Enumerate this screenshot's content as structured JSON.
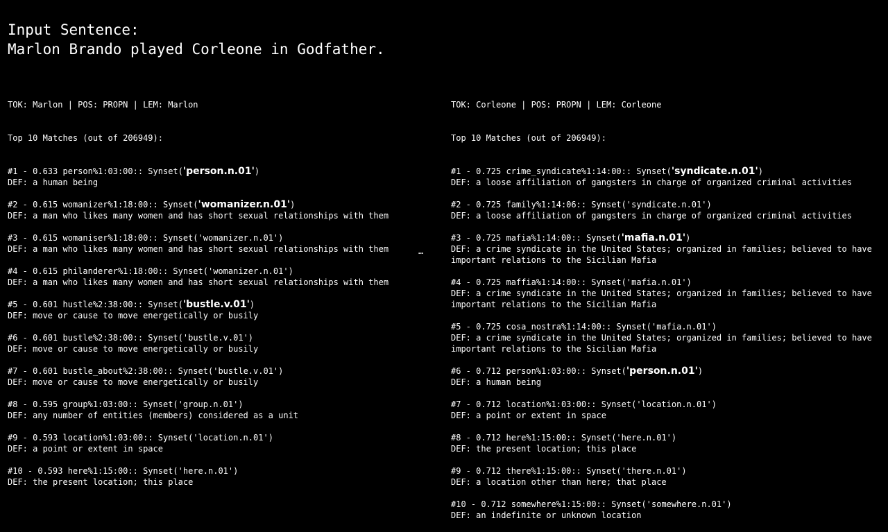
{
  "title": {
    "label": "Input Sentence:",
    "sentence": "Marlon Brando played Corleone in Godfather."
  },
  "ellipsis": "⋯",
  "columns": [
    {
      "header": "TOK: Marlon | POS: PROPN | LEM: Marlon",
      "top_matches": "Top 10 Matches (out of 206949):",
      "matches": [
        {
          "prefix": "#1 - 0.633 person%1:03:00:: Synset(",
          "synset": "'person.n.01'",
          "suffix": ")",
          "bold": true,
          "def": "DEF: a human being",
          "def2": ""
        },
        {
          "prefix": "#2 - 0.615 womanizer%1:18:00:: Synset(",
          "synset": "'womanizer.n.01'",
          "suffix": ")",
          "bold": true,
          "def": "DEF: a man who likes many women and has short sexual relationships with them",
          "def2": ""
        },
        {
          "prefix": "#3 - 0.615 womaniser%1:18:00:: Synset(",
          "synset": "'womanizer.n.01'",
          "suffix": ")",
          "bold": false,
          "def": "DEF: a man who likes many women and has short sexual relationships with them",
          "def2": ""
        },
        {
          "prefix": "#4 - 0.615 philanderer%1:18:00:: Synset(",
          "synset": "'womanizer.n.01'",
          "suffix": ")",
          "bold": false,
          "def": "DEF: a man who likes many women and has short sexual relationships with them",
          "def2": ""
        },
        {
          "prefix": "#5 - 0.601 hustle%2:38:00:: Synset(",
          "synset": "'bustle.v.01'",
          "suffix": ")",
          "bold": true,
          "def": "DEF: move or cause to move energetically or busily",
          "def2": ""
        },
        {
          "prefix": "#6 - 0.601 bustle%2:38:00:: Synset(",
          "synset": "'bustle.v.01'",
          "suffix": ")",
          "bold": false,
          "def": "DEF: move or cause to move energetically or busily",
          "def2": ""
        },
        {
          "prefix": "#7 - 0.601 bustle_about%2:38:00:: Synset(",
          "synset": "'bustle.v.01'",
          "suffix": ")",
          "bold": false,
          "def": "DEF: move or cause to move energetically or busily",
          "def2": ""
        },
        {
          "prefix": "#8 - 0.595 group%1:03:00:: Synset(",
          "synset": "'group.n.01'",
          "suffix": ")",
          "bold": false,
          "def": "DEF: any number of entities (members) considered as a unit",
          "def2": ""
        },
        {
          "prefix": "#9 - 0.593 location%1:03:00:: Synset(",
          "synset": "'location.n.01'",
          "suffix": ")",
          "bold": false,
          "def": "DEF: a point or extent in space",
          "def2": ""
        },
        {
          "prefix": "#10 - 0.593 here%1:15:00:: Synset(",
          "synset": "'here.n.01'",
          "suffix": ")",
          "bold": false,
          "def": "DEF: the present location; this place",
          "def2": ""
        }
      ]
    },
    {
      "header": "TOK: Corleone | POS: PROPN | LEM: Corleone",
      "top_matches": "Top 10 Matches (out of 206949):",
      "matches": [
        {
          "prefix": "#1 - 0.725 crime_syndicate%1:14:00:: Synset(",
          "synset": "'syndicate.n.01'",
          "suffix": ")",
          "bold": true,
          "def": "DEF: a loose affiliation of gangsters in charge of organized criminal activities",
          "def2": ""
        },
        {
          "prefix": "#2 - 0.725 family%1:14:06:: Synset(",
          "synset": "'syndicate.n.01'",
          "suffix": ")",
          "bold": false,
          "def": "DEF: a loose affiliation of gangsters in charge of organized criminal activities",
          "def2": ""
        },
        {
          "prefix": "#3 - 0.725 mafia%1:14:00:: Synset(",
          "synset": "'mafia.n.01'",
          "suffix": ")",
          "bold": true,
          "def": "DEF: a crime syndicate in the United States; organized in families; believed to have",
          "def2": "important relations to the Sicilian Mafia"
        },
        {
          "prefix": "#4 - 0.725 maffia%1:14:00:: Synset(",
          "synset": "'mafia.n.01'",
          "suffix": ")",
          "bold": false,
          "def": "DEF: a crime syndicate in the United States; organized in families; believed to have",
          "def2": "important relations to the Sicilian Mafia"
        },
        {
          "prefix": "#5 - 0.725 cosa_nostra%1:14:00:: Synset(",
          "synset": "'mafia.n.01'",
          "suffix": ")",
          "bold": false,
          "def": "DEF: a crime syndicate in the United States; organized in families; believed to have",
          "def2": "important relations to the Sicilian Mafia"
        },
        {
          "prefix": "#6 - 0.712 person%1:03:00:: Synset(",
          "synset": "'person.n.01'",
          "suffix": ")",
          "bold": true,
          "def": "DEF: a human being",
          "def2": ""
        },
        {
          "prefix": "#7 - 0.712 location%1:03:00:: Synset(",
          "synset": "'location.n.01'",
          "suffix": ")",
          "bold": false,
          "def": "DEF: a point or extent in space",
          "def2": ""
        },
        {
          "prefix": "#8 - 0.712 here%1:15:00:: Synset(",
          "synset": "'here.n.01'",
          "suffix": ")",
          "bold": false,
          "def": "DEF: the present location; this place",
          "def2": ""
        },
        {
          "prefix": "#9 - 0.712 there%1:15:00:: Synset(",
          "synset": "'there.n.01'",
          "suffix": ")",
          "bold": false,
          "def": "DEF: a location other than here; that place",
          "def2": ""
        },
        {
          "prefix": "#10 - 0.712 somewhere%1:15:00:: Synset(",
          "synset": "'somewhere.n.01'",
          "suffix": ")",
          "bold": false,
          "def": "DEF: an indefinite or unknown location",
          "def2": ""
        }
      ]
    }
  ]
}
